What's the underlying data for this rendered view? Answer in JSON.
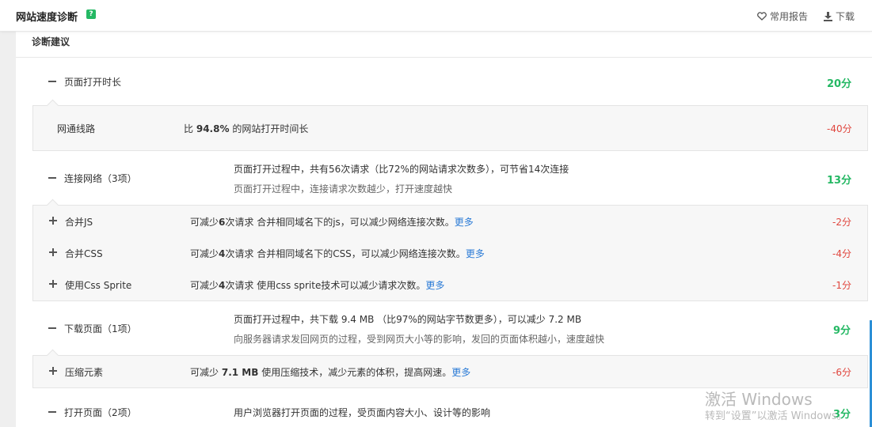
{
  "header": {
    "title": "网站速度诊断",
    "help_icon": "?",
    "fav_label": "常用报告",
    "download_label": "下载"
  },
  "panel": {
    "title": "诊断建议"
  },
  "sections": {
    "page_open": {
      "label": "页面打开时长",
      "score": "20分",
      "items": {
        "line": {
          "label": "网通线路",
          "desc_pre": "比",
          "desc_bold": "94.8%",
          "desc_post": "的网站打开时间长",
          "score": "-40分"
        }
      }
    },
    "connect": {
      "label": "连接网络（3项）",
      "desc": "页面打开过程中，共有56次请求（比72%的网站请求次数多），可节省14次连接",
      "sub": "页面打开过程中，连接请求次数越少，打开速度越快",
      "score": "13分",
      "items": {
        "js": {
          "label": "合并JS",
          "pre": "可减少",
          "num": "6",
          "mid": "次请求 合并相同域名下的js，可以减少网络连接次数。",
          "more": "更多",
          "score": "-2分"
        },
        "css": {
          "label": "合并CSS",
          "pre": "可减少",
          "num": "4",
          "mid": "次请求 合并相同域名下的CSS，可以减少网络连接次数。",
          "more": "更多",
          "score": "-4分"
        },
        "sprite": {
          "label": "使用Css Sprite",
          "pre": "可减少",
          "num": "4",
          "mid": "次请求 使用css sprite技术可以减少请求次数。",
          "more": "更多",
          "score": "-1分"
        }
      }
    },
    "download": {
      "label": "下载页面（1项）",
      "desc": "页面打开过程中，共下载 9.4 MB （比97%的网站字节数更多），可以减少 7.2 MB",
      "sub": "向服务器请求发回网页的过程，受到网页大小等的影响，发回的页面体积越小，速度越快",
      "score": "9分",
      "items": {
        "compress": {
          "label": "压缩元素",
          "pre": "可减少",
          "num": "7.1 MB",
          "mid": "使用压缩技术，减少元素的体积，提高网速。",
          "more": "更多",
          "score": "-6分"
        }
      }
    },
    "open": {
      "label": "打开页面（2项）",
      "desc": "用户浏览器打开页面的过程，受页面内容大小、设计等的影响",
      "score": "3分"
    }
  },
  "watermark": {
    "line1": "激活 Windows",
    "line2": "转到“设置”以激活 Windows。"
  }
}
